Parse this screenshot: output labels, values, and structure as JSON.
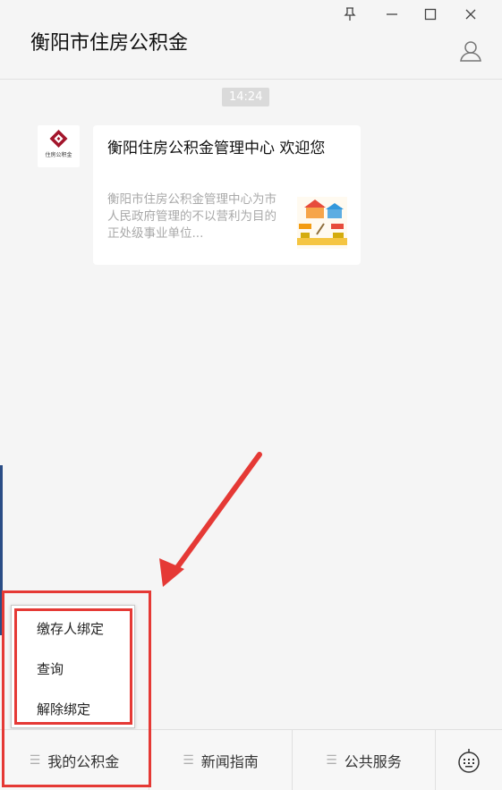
{
  "window": {
    "title": "衡阳市住房公积金",
    "buttons": {
      "pin": "⊥",
      "minimize": "—",
      "maximize": "□",
      "close": "✕"
    }
  },
  "chat": {
    "timestamp": "14:24",
    "avatar_label": "住房公积金",
    "card": {
      "title": "衡阳住房公积金管理中心 欢迎您",
      "description": "衡阳市住房公积金管理中心为市人民政府管理的不以营利为目的正处级事业单位..."
    }
  },
  "popup_menu": {
    "items": [
      "缴存人绑定",
      "查询",
      "解除绑定"
    ]
  },
  "bottom_menu": {
    "tabs": [
      {
        "label": "我的公积金",
        "icon": "menu-icon"
      },
      {
        "label": "新闻指南",
        "icon": "menu-icon"
      },
      {
        "label": "公共服务",
        "icon": "menu-icon"
      }
    ],
    "keyboard_icon": "keyboard-icon"
  },
  "colors": {
    "highlight": "#e53935",
    "logo": "#a3152b"
  }
}
